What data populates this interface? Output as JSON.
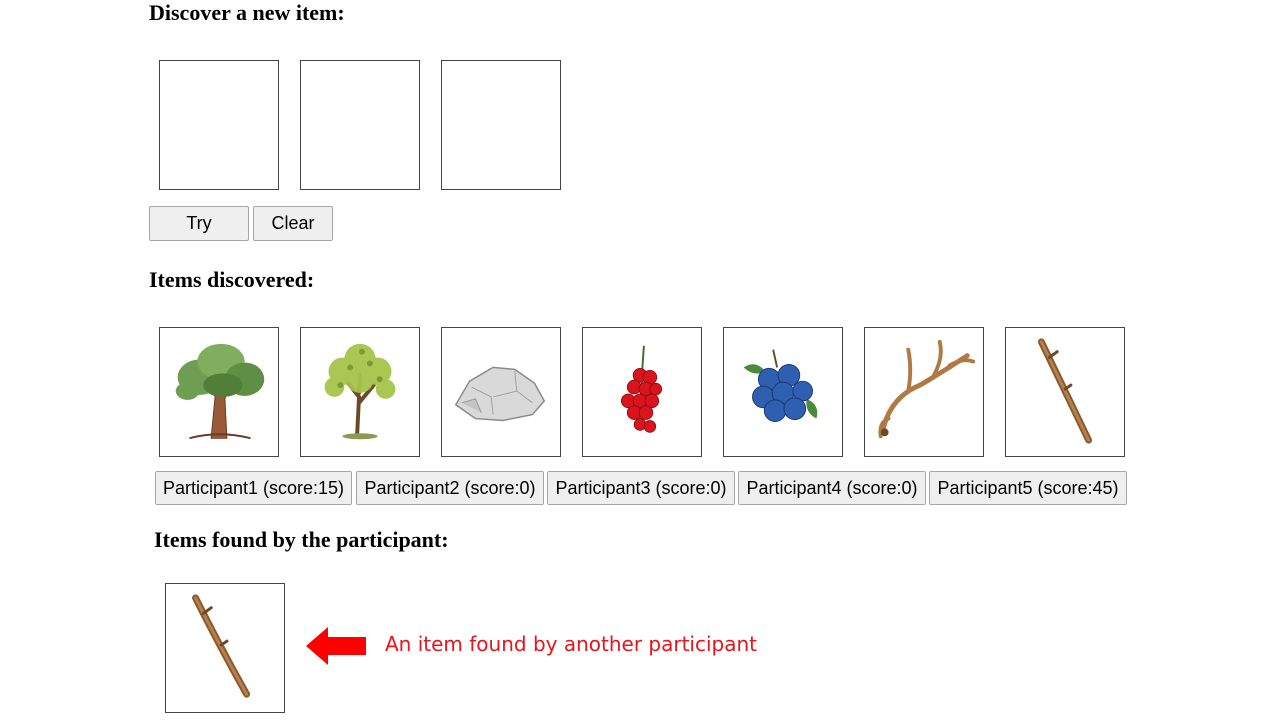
{
  "discover": {
    "heading": "Discover a new item:",
    "slots": [
      "",
      "",
      ""
    ],
    "try_label": "Try",
    "clear_label": "Clear"
  },
  "discovered": {
    "heading": "Items discovered:",
    "items": [
      {
        "icon": "oak-tree-icon"
      },
      {
        "icon": "young-tree-icon"
      },
      {
        "icon": "stone-icon"
      },
      {
        "icon": "red-currant-icon"
      },
      {
        "icon": "blueberry-icon"
      },
      {
        "icon": "antler-icon"
      },
      {
        "icon": "stick-icon"
      }
    ]
  },
  "participants": [
    {
      "label": "Participant1 (score:15)"
    },
    {
      "label": "Participant2 (score:0)"
    },
    {
      "label": "Participant3 (score:0)"
    },
    {
      "label": "Participant4 (score:0)"
    },
    {
      "label": "Participant5 (score:45)"
    }
  ],
  "found": {
    "heading": "Items found by the participant:",
    "items": [
      {
        "icon": "stick-icon"
      }
    ]
  },
  "annotation": {
    "text": "An item found by another participant",
    "color": "#e8141c",
    "arrow_icon": "left-arrow-icon"
  }
}
